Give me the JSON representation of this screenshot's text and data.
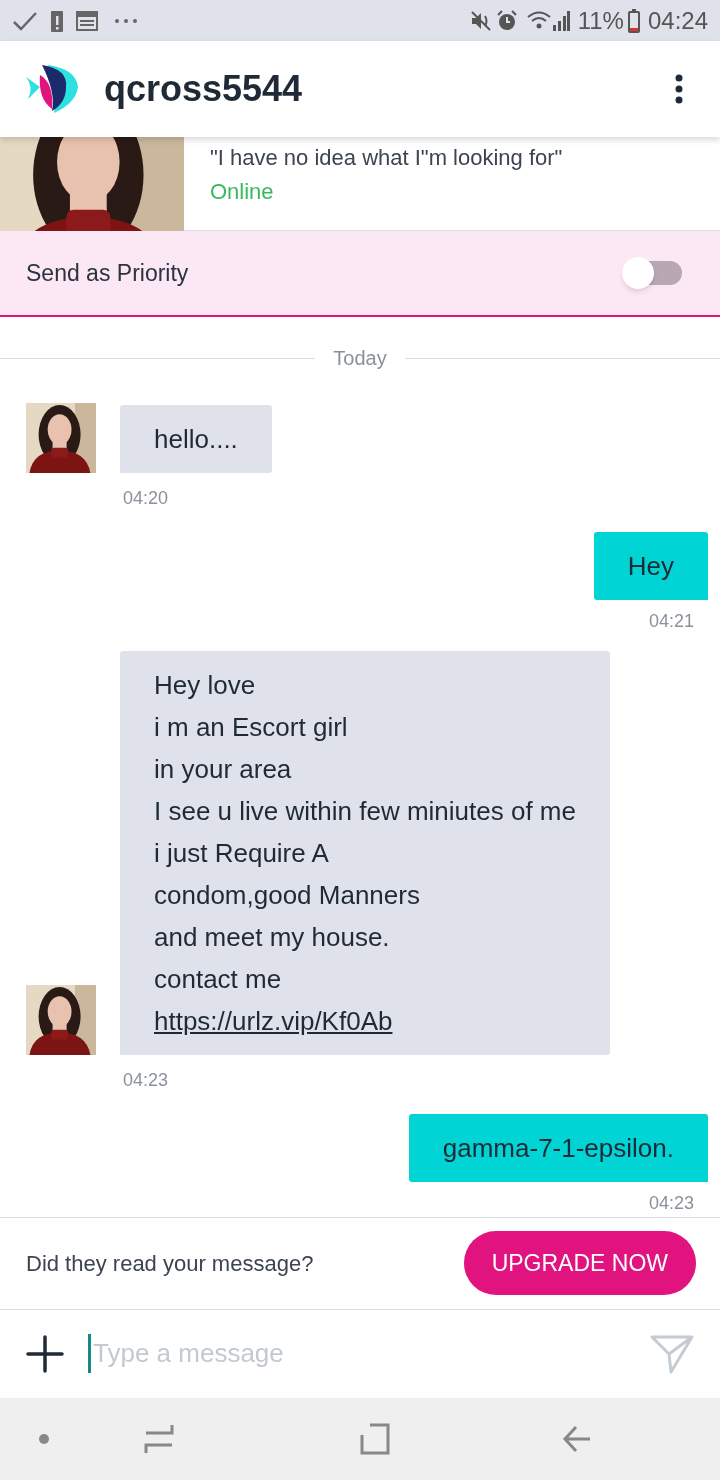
{
  "status_bar": {
    "battery": "11%",
    "time": "04:24"
  },
  "header": {
    "title": "qcross5544"
  },
  "profile": {
    "quote": "\"I have no idea what I\"m looking for\"",
    "status": "Online"
  },
  "priority": {
    "label": "Send as Priority",
    "on": false
  },
  "date_divider": "Today",
  "messages": [
    {
      "kind": "incoming",
      "lines": [
        "hello...."
      ],
      "time": "04:20"
    },
    {
      "kind": "outgoing",
      "lines": [
        "Hey"
      ],
      "time": "04:21"
    },
    {
      "kind": "incoming",
      "lines": [
        "Hey love",
        "i m an Escort girl",
        "in your area",
        "I see u live within few miniutes of me",
        "i just Require A",
        "condom,good Manners",
        "and meet my house.",
        "contact me"
      ],
      "link": "https://urlz.vip/Kf0Ab",
      "time": "04:23"
    },
    {
      "kind": "outgoing",
      "lines": [
        "gamma-7-1-epsilon."
      ],
      "time": "04:23"
    }
  ],
  "upgrade": {
    "prompt": "Did they read your message?",
    "button": "UPGRADE NOW"
  },
  "composer": {
    "placeholder": "Type a message"
  }
}
